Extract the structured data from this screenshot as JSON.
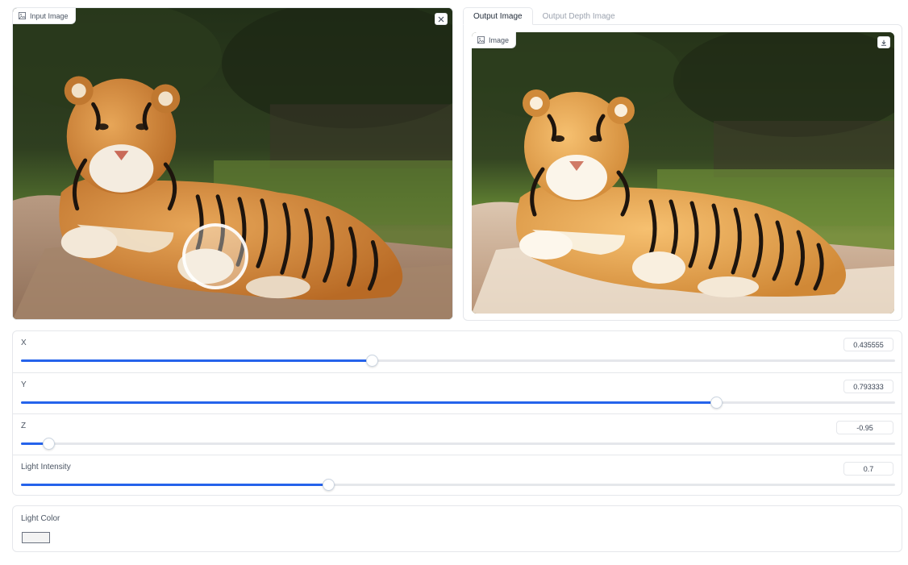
{
  "input_image": {
    "label": "Input Image",
    "label_icon": "image-icon",
    "clear_icon": "close-icon"
  },
  "output": {
    "tabs": [
      {
        "label": "Output Image",
        "active": true
      },
      {
        "label": "Output Depth Image",
        "active": false
      }
    ],
    "image_label": "Image",
    "label_icon": "image-icon",
    "download_icon": "download-icon"
  },
  "sliders": [
    {
      "label": "X",
      "value": "0.435555",
      "fraction": 0.4014
    },
    {
      "label": "Y",
      "value": "0.793333",
      "fraction": 0.7952
    },
    {
      "label": "Z",
      "value": "-0.95",
      "fraction": 0.0314
    },
    {
      "label": "Light Intensity",
      "value": "0.7",
      "fraction": 0.3515
    }
  ],
  "light_color": {
    "label": "Light Color",
    "value": "#f3f3f3"
  },
  "colors": {
    "accent": "#2563eb",
    "border": "#e5e7eb"
  }
}
